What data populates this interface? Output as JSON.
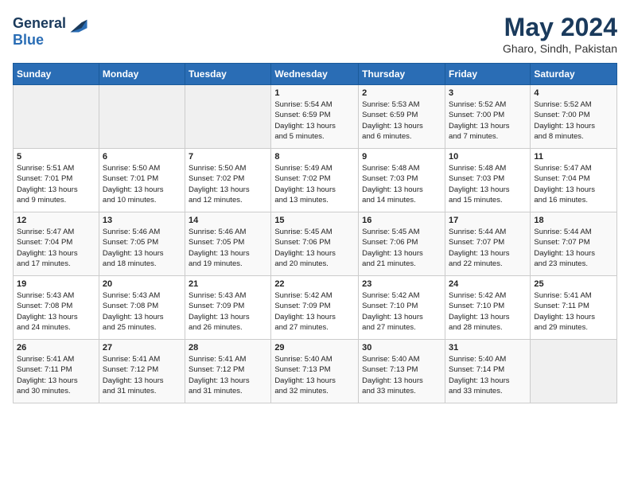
{
  "header": {
    "logo_line1": "General",
    "logo_line2": "Blue",
    "month_year": "May 2024",
    "location": "Gharo, Sindh, Pakistan"
  },
  "weekdays": [
    "Sunday",
    "Monday",
    "Tuesday",
    "Wednesday",
    "Thursday",
    "Friday",
    "Saturday"
  ],
  "weeks": [
    [
      {
        "day": "",
        "info": ""
      },
      {
        "day": "",
        "info": ""
      },
      {
        "day": "",
        "info": ""
      },
      {
        "day": "1",
        "info": "Sunrise: 5:54 AM\nSunset: 6:59 PM\nDaylight: 13 hours\nand 5 minutes."
      },
      {
        "day": "2",
        "info": "Sunrise: 5:53 AM\nSunset: 6:59 PM\nDaylight: 13 hours\nand 6 minutes."
      },
      {
        "day": "3",
        "info": "Sunrise: 5:52 AM\nSunset: 7:00 PM\nDaylight: 13 hours\nand 7 minutes."
      },
      {
        "day": "4",
        "info": "Sunrise: 5:52 AM\nSunset: 7:00 PM\nDaylight: 13 hours\nand 8 minutes."
      }
    ],
    [
      {
        "day": "5",
        "info": "Sunrise: 5:51 AM\nSunset: 7:01 PM\nDaylight: 13 hours\nand 9 minutes."
      },
      {
        "day": "6",
        "info": "Sunrise: 5:50 AM\nSunset: 7:01 PM\nDaylight: 13 hours\nand 10 minutes."
      },
      {
        "day": "7",
        "info": "Sunrise: 5:50 AM\nSunset: 7:02 PM\nDaylight: 13 hours\nand 12 minutes."
      },
      {
        "day": "8",
        "info": "Sunrise: 5:49 AM\nSunset: 7:02 PM\nDaylight: 13 hours\nand 13 minutes."
      },
      {
        "day": "9",
        "info": "Sunrise: 5:48 AM\nSunset: 7:03 PM\nDaylight: 13 hours\nand 14 minutes."
      },
      {
        "day": "10",
        "info": "Sunrise: 5:48 AM\nSunset: 7:03 PM\nDaylight: 13 hours\nand 15 minutes."
      },
      {
        "day": "11",
        "info": "Sunrise: 5:47 AM\nSunset: 7:04 PM\nDaylight: 13 hours\nand 16 minutes."
      }
    ],
    [
      {
        "day": "12",
        "info": "Sunrise: 5:47 AM\nSunset: 7:04 PM\nDaylight: 13 hours\nand 17 minutes."
      },
      {
        "day": "13",
        "info": "Sunrise: 5:46 AM\nSunset: 7:05 PM\nDaylight: 13 hours\nand 18 minutes."
      },
      {
        "day": "14",
        "info": "Sunrise: 5:46 AM\nSunset: 7:05 PM\nDaylight: 13 hours\nand 19 minutes."
      },
      {
        "day": "15",
        "info": "Sunrise: 5:45 AM\nSunset: 7:06 PM\nDaylight: 13 hours\nand 20 minutes."
      },
      {
        "day": "16",
        "info": "Sunrise: 5:45 AM\nSunset: 7:06 PM\nDaylight: 13 hours\nand 21 minutes."
      },
      {
        "day": "17",
        "info": "Sunrise: 5:44 AM\nSunset: 7:07 PM\nDaylight: 13 hours\nand 22 minutes."
      },
      {
        "day": "18",
        "info": "Sunrise: 5:44 AM\nSunset: 7:07 PM\nDaylight: 13 hours\nand 23 minutes."
      }
    ],
    [
      {
        "day": "19",
        "info": "Sunrise: 5:43 AM\nSunset: 7:08 PM\nDaylight: 13 hours\nand 24 minutes."
      },
      {
        "day": "20",
        "info": "Sunrise: 5:43 AM\nSunset: 7:08 PM\nDaylight: 13 hours\nand 25 minutes."
      },
      {
        "day": "21",
        "info": "Sunrise: 5:43 AM\nSunset: 7:09 PM\nDaylight: 13 hours\nand 26 minutes."
      },
      {
        "day": "22",
        "info": "Sunrise: 5:42 AM\nSunset: 7:09 PM\nDaylight: 13 hours\nand 27 minutes."
      },
      {
        "day": "23",
        "info": "Sunrise: 5:42 AM\nSunset: 7:10 PM\nDaylight: 13 hours\nand 27 minutes."
      },
      {
        "day": "24",
        "info": "Sunrise: 5:42 AM\nSunset: 7:10 PM\nDaylight: 13 hours\nand 28 minutes."
      },
      {
        "day": "25",
        "info": "Sunrise: 5:41 AM\nSunset: 7:11 PM\nDaylight: 13 hours\nand 29 minutes."
      }
    ],
    [
      {
        "day": "26",
        "info": "Sunrise: 5:41 AM\nSunset: 7:11 PM\nDaylight: 13 hours\nand 30 minutes."
      },
      {
        "day": "27",
        "info": "Sunrise: 5:41 AM\nSunset: 7:12 PM\nDaylight: 13 hours\nand 31 minutes."
      },
      {
        "day": "28",
        "info": "Sunrise: 5:41 AM\nSunset: 7:12 PM\nDaylight: 13 hours\nand 31 minutes."
      },
      {
        "day": "29",
        "info": "Sunrise: 5:40 AM\nSunset: 7:13 PM\nDaylight: 13 hours\nand 32 minutes."
      },
      {
        "day": "30",
        "info": "Sunrise: 5:40 AM\nSunset: 7:13 PM\nDaylight: 13 hours\nand 33 minutes."
      },
      {
        "day": "31",
        "info": "Sunrise: 5:40 AM\nSunset: 7:14 PM\nDaylight: 13 hours\nand 33 minutes."
      },
      {
        "day": "",
        "info": ""
      }
    ]
  ]
}
